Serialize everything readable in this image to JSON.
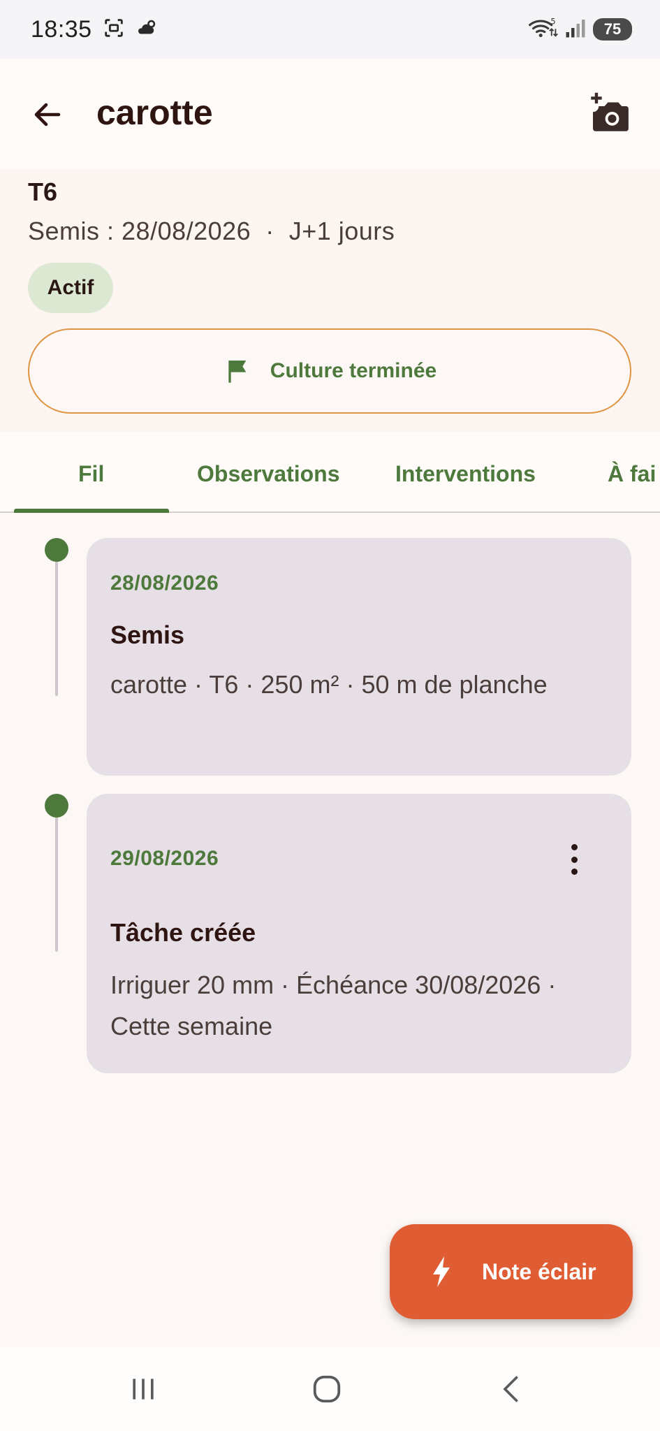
{
  "status_bar": {
    "time": "18:35",
    "battery": "75",
    "icons": [
      "screenshot-icon",
      "weather-icon",
      "wifi-icon",
      "signal-icon"
    ]
  },
  "appbar": {
    "title": "carotte",
    "back_icon": "arrow-left-icon",
    "action_icon": "add-photo-icon"
  },
  "header": {
    "plot": "T6",
    "sow_line": "Semis : 28/08/2026  ·  J+1 jours",
    "status_chip": "Actif",
    "end_button_label": "Culture terminée",
    "end_button_icon": "flag-icon"
  },
  "tabs": [
    {
      "label": "Fil",
      "selected": true
    },
    {
      "label": "Observations",
      "selected": false
    },
    {
      "label": "Interventions",
      "selected": false
    },
    {
      "label": "À fai",
      "selected": false
    }
  ],
  "timeline": [
    {
      "date": "28/08/2026",
      "title": "Semis",
      "description": "carotte · T6 · 250 m² · 50 m de planche",
      "has_menu": false
    },
    {
      "date": "29/08/2026",
      "title": "Tâche créée",
      "description": "Irriguer 20 mm · Échéance 30/08/2026 · Cette semaine",
      "has_menu": true
    }
  ],
  "fab": {
    "label": "Note éclair",
    "icon": "lightning-icon"
  },
  "navbar": {
    "items": [
      "recent-apps-icon",
      "home-icon",
      "back-nav-icon"
    ]
  },
  "colors": {
    "accent_green": "#4d7a3c",
    "fab_orange": "#e05c33",
    "outline_orange": "#de9442",
    "card_bg": "#e6e0e6"
  }
}
